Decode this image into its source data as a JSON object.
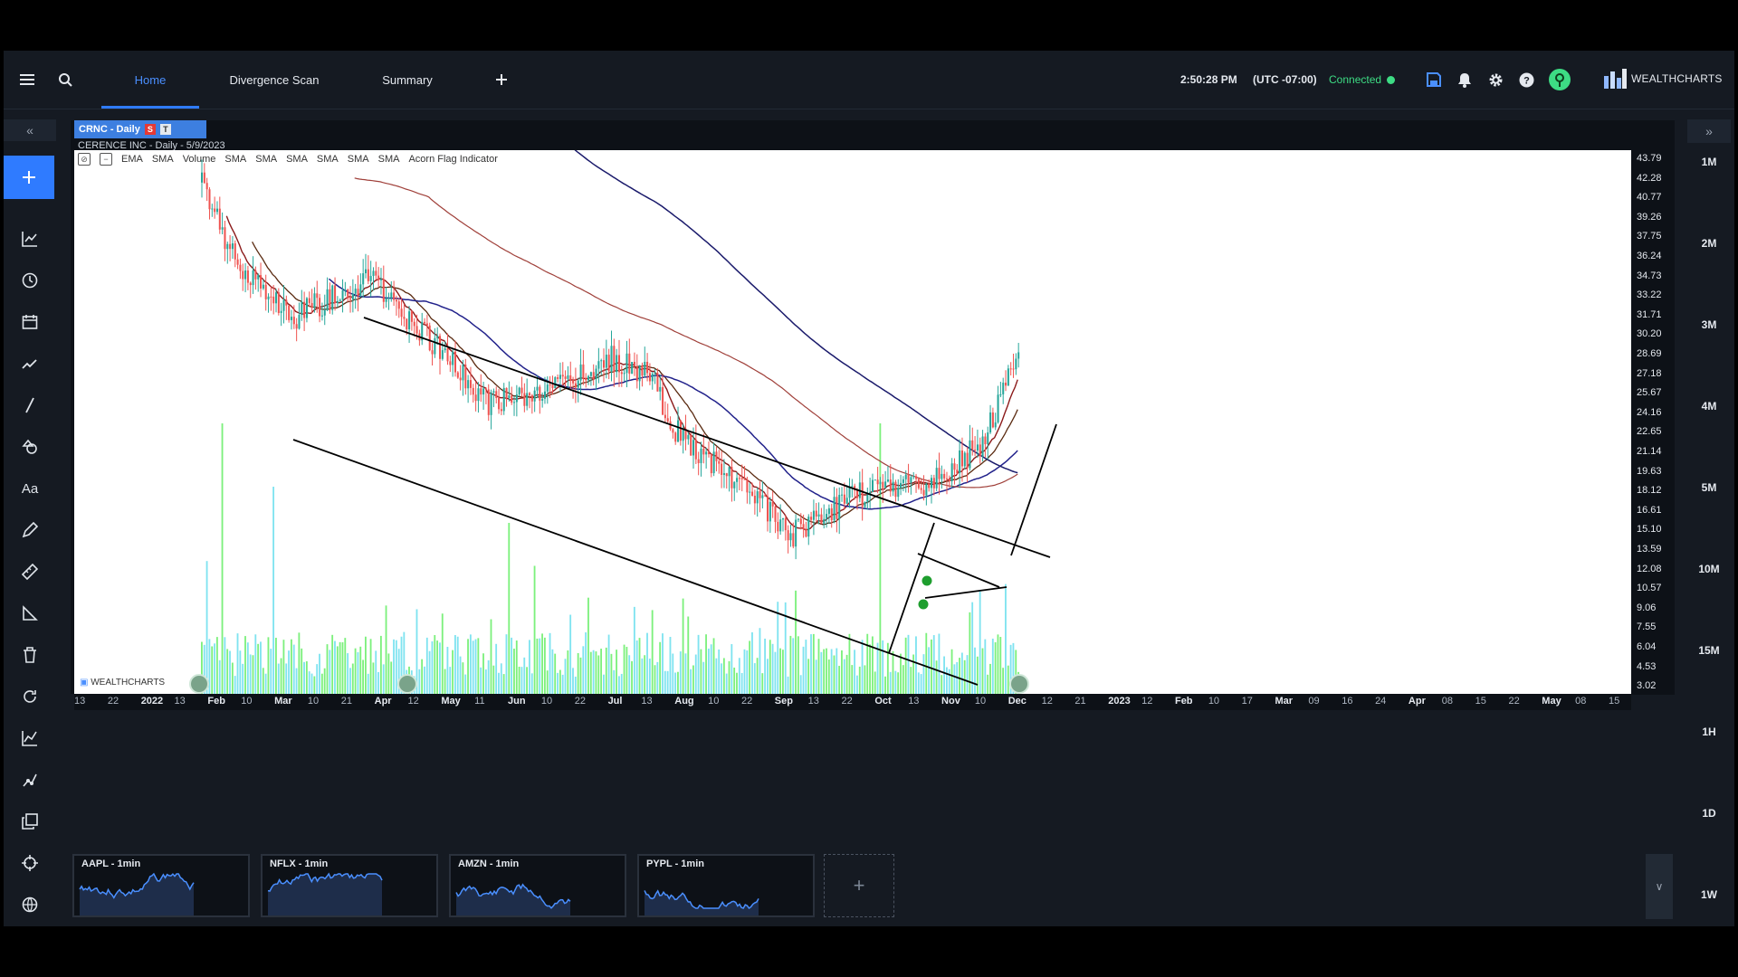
{
  "topbar": {
    "tabs": [
      {
        "label": "Home",
        "active": true
      },
      {
        "label": "Divergence Scan",
        "active": false
      },
      {
        "label": "Summary",
        "active": false
      }
    ],
    "time": "2:50:28 PM",
    "timezone": "(UTC -07:00)",
    "connection": "Connected",
    "brand": "WEALTHCHARTS"
  },
  "chart": {
    "header": "CRNC - Daily",
    "chip_s": "S",
    "chip_t": "T",
    "subtitle": "CERENCE INC - Daily - 5/9/2023",
    "indicators": [
      "EMA",
      "SMA",
      "Volume",
      "SMA",
      "SMA",
      "SMA",
      "SMA",
      "SMA",
      "SMA",
      "Acorn Flag Indicator"
    ],
    "watermark": "WEALTHCHARTS",
    "price_labels": [
      "43.79",
      "42.28",
      "40.77",
      "39.26",
      "37.75",
      "36.24",
      "34.73",
      "33.22",
      "31.71",
      "30.20",
      "28.69",
      "27.18",
      "25.67",
      "24.16",
      "22.65",
      "21.14",
      "19.63",
      "18.12",
      "16.61",
      "15.10",
      "13.59",
      "12.08",
      "10.57",
      "9.06",
      "7.55",
      "6.04",
      "4.53",
      "3.02"
    ],
    "date_labels": [
      {
        "t": "13",
        "b": false
      },
      {
        "t": "22",
        "b": false
      },
      {
        "t": "2022",
        "b": true
      },
      {
        "t": "13",
        "b": false
      },
      {
        "t": "Feb",
        "b": true
      },
      {
        "t": "10",
        "b": false
      },
      {
        "t": "Mar",
        "b": true
      },
      {
        "t": "10",
        "b": false
      },
      {
        "t": "21",
        "b": false
      },
      {
        "t": "Apr",
        "b": true
      },
      {
        "t": "12",
        "b": false
      },
      {
        "t": "May",
        "b": true
      },
      {
        "t": "11",
        "b": false
      },
      {
        "t": "Jun",
        "b": true
      },
      {
        "t": "10",
        "b": false
      },
      {
        "t": "22",
        "b": false
      },
      {
        "t": "Jul",
        "b": true
      },
      {
        "t": "13",
        "b": false
      },
      {
        "t": "Aug",
        "b": true
      },
      {
        "t": "10",
        "b": false
      },
      {
        "t": "22",
        "b": false
      },
      {
        "t": "Sep",
        "b": true
      },
      {
        "t": "13",
        "b": false
      },
      {
        "t": "22",
        "b": false
      },
      {
        "t": "Oct",
        "b": true
      },
      {
        "t": "13",
        "b": false
      },
      {
        "t": "Nov",
        "b": true
      },
      {
        "t": "10",
        "b": false
      },
      {
        "t": "Dec",
        "b": true
      },
      {
        "t": "12",
        "b": false
      },
      {
        "t": "21",
        "b": false
      },
      {
        "t": "2023",
        "b": true
      },
      {
        "t": "12",
        "b": false
      },
      {
        "t": "Feb",
        "b": true
      },
      {
        "t": "10",
        "b": false
      },
      {
        "t": "17",
        "b": false
      },
      {
        "t": "Mar",
        "b": true
      },
      {
        "t": "09",
        "b": false
      },
      {
        "t": "16",
        "b": false
      },
      {
        "t": "24",
        "b": false
      },
      {
        "t": "Apr",
        "b": true
      },
      {
        "t": "08",
        "b": false
      },
      {
        "t": "15",
        "b": false
      },
      {
        "t": "22",
        "b": false
      },
      {
        "t": "May",
        "b": true
      },
      {
        "t": "08",
        "b": false
      },
      {
        "t": "15",
        "b": false
      }
    ]
  },
  "timeframes": [
    "1M",
    "2M",
    "3M",
    "4M",
    "5M",
    "10M",
    "15M",
    "1H",
    "1D",
    "1W"
  ],
  "watchlist": [
    {
      "label": "AAPL - 1min"
    },
    {
      "label": "NFLX - 1min"
    },
    {
      "label": "AMZN - 1min"
    },
    {
      "label": "PYPL - 1min"
    }
  ],
  "colors": {
    "accent": "#2f7bff",
    "connected": "#3ddc84",
    "candle_up": "#26a69a",
    "candle_down": "#ef5350",
    "volume_up": "#7cf07c",
    "volume_down": "#7fe3f0"
  }
}
